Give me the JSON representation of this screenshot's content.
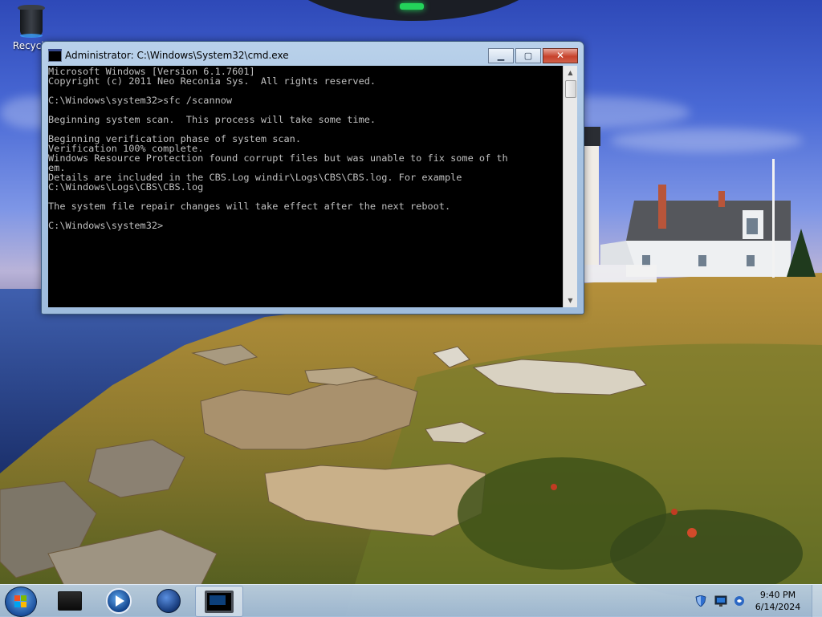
{
  "desktop": {
    "icons": [
      {
        "label": "Recycle",
        "icon": "recycle-bin-icon"
      }
    ]
  },
  "window": {
    "title": "Administrator: C:\\Windows\\System32\\cmd.exe",
    "controls": {
      "minimize": "▁",
      "maximize": "▢",
      "close": "✕"
    },
    "console_lines": [
      "Microsoft Windows [Version 6.1.7601]",
      "Copyright (c) 2011 Neo Reconia Sys.  All rights reserved.",
      "",
      "C:\\Windows\\system32>sfc /scannow",
      "",
      "Beginning system scan.  This process will take some time.",
      "",
      "Beginning verification phase of system scan.",
      "Verification 100% complete.",
      "Windows Resource Protection found corrupt files but was unable to fix some of th",
      "em.",
      "Details are included in the CBS.Log windir\\Logs\\CBS\\CBS.log. For example",
      "C:\\Windows\\Logs\\CBS\\CBS.log",
      "",
      "The system file repair changes will take effect after the next reboot.",
      "",
      "C:\\Windows\\system32>"
    ],
    "colors": {
      "console_bg": "#000000",
      "console_fg": "#c0c0c0"
    }
  },
  "taskbar": {
    "buttons": [
      {
        "icon": "monitor-icon",
        "active": false
      },
      {
        "icon": "media-player-icon",
        "active": false
      },
      {
        "icon": "globe-icon",
        "active": false
      },
      {
        "icon": "command-prompt-icon",
        "active": true
      }
    ],
    "tray": {
      "icons": [
        "security-shield-icon",
        "network-icon",
        "volume-icon"
      ]
    },
    "clock": {
      "time": "9:40 PM",
      "date": "6/14/2024"
    }
  }
}
